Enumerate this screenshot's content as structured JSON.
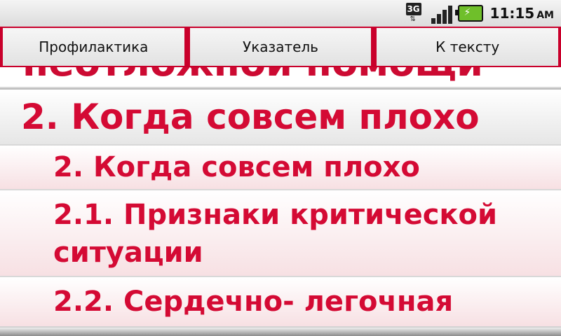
{
  "status_bar": {
    "network_label": "3G",
    "time": "11:15",
    "ampm": "AM",
    "icons": [
      "3g-icon",
      "signal-icon",
      "battery-charging-icon"
    ]
  },
  "tabs": [
    {
      "label": "Профилактика"
    },
    {
      "label": "Указатель"
    },
    {
      "label": "К тексту"
    }
  ],
  "content": {
    "partial_title": "неотложной помощи",
    "section_header": "2. Когда совсем плохо",
    "items": [
      {
        "label": "2. Когда совсем плохо"
      },
      {
        "label": "2.1. Признаки критической ситуации"
      },
      {
        "label": "2.2. Сердечно- легочная"
      }
    ]
  },
  "colors": {
    "accent_red": "#d40a34",
    "tab_border": "#c9002b",
    "statusbar_bg": "#e6e6e6"
  }
}
